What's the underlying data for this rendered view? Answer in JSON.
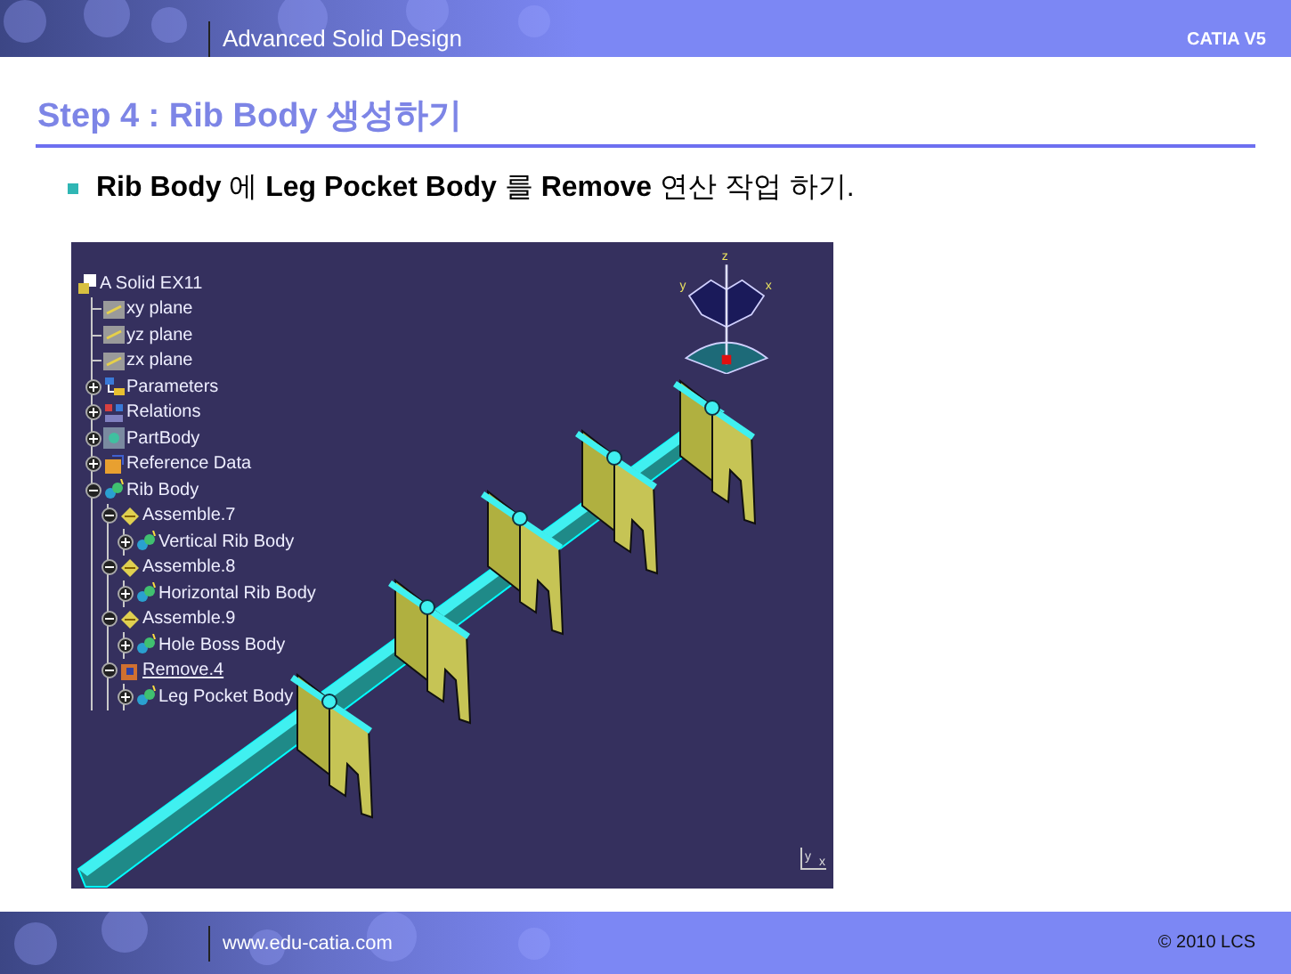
{
  "header": {
    "course": "Advanced Solid Design",
    "product": "CATIA V5"
  },
  "title": "Step 4 : Rib Body 생성하기",
  "bullet": "**Rib Body** 에 **Leg Pocket Body** 를 **Remove** 연산 작업 하기.",
  "viewport": {
    "tree": [
      {
        "label": "A Solid EX11",
        "kind": "part",
        "current": false,
        "children": [
          {
            "label": "xy plane",
            "kind": "plane",
            "current": false
          },
          {
            "label": "yz plane",
            "kind": "plane",
            "current": false
          },
          {
            "label": "zx plane",
            "kind": "plane",
            "current": false
          },
          {
            "label": "Parameters",
            "kind": "parameters",
            "current": false,
            "expanded": false
          },
          {
            "label": "Relations",
            "kind": "relations",
            "current": false,
            "expanded": false
          },
          {
            "label": "PartBody",
            "kind": "partbody",
            "current": false,
            "expanded": false
          },
          {
            "label": "Reference Data",
            "kind": "reference",
            "current": false,
            "expanded": false
          },
          {
            "label": "Rib Body",
            "kind": "body",
            "current": false,
            "expanded": true,
            "children": [
              {
                "label": "Assemble.7",
                "kind": "assemble",
                "current": false,
                "expanded": true,
                "children": [
                  {
                    "label": "Vertical Rib Body",
                    "kind": "body",
                    "current": false,
                    "expanded": false
                  }
                ]
              },
              {
                "label": "Assemble.8",
                "kind": "assemble",
                "current": false,
                "expanded": true,
                "children": [
                  {
                    "label": "Horizontal Rib Body",
                    "kind": "body",
                    "current": false,
                    "expanded": false
                  }
                ]
              },
              {
                "label": "Assemble.9",
                "kind": "assemble",
                "current": false,
                "expanded": true,
                "children": [
                  {
                    "label": "Hole Boss Body",
                    "kind": "body",
                    "current": false,
                    "expanded": false
                  }
                ]
              },
              {
                "label": "Remove.4",
                "kind": "remove",
                "current": true,
                "expanded": true,
                "children": [
                  {
                    "label": "Leg Pocket Body",
                    "kind": "body",
                    "current": false,
                    "expanded": false
                  }
                ]
              }
            ]
          }
        ]
      }
    ],
    "compass_labels": [
      "z",
      "y",
      "x"
    ],
    "axis_labels": [
      "y",
      "x"
    ]
  },
  "footer": {
    "site": "www.edu-catia.com",
    "copyright": "© 2010 LCS"
  }
}
